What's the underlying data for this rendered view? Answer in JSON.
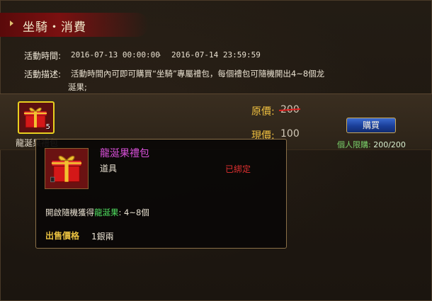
{
  "panel": {
    "title": "坐騎・消費"
  },
  "activity": {
    "time_label": "活動時間:",
    "time_start": "2016-07-13 00:00:00",
    "time_sep": "-",
    "time_end": "2016-07-14 23:59:59",
    "desc_label": "活動描述:",
    "desc_line1": "活動時間內可即可購買“坐騎”專屬禮包，每個禮包可隨機開出4~8個龙",
    "desc_line2": "涎果;"
  },
  "item": {
    "name": "龍涎果禮包",
    "quantity": "5",
    "original_price_label": "原價:",
    "original_price": "200",
    "current_price_label": "現價:",
    "current_price": "100",
    "buy_label": "購買",
    "limit_label": "個人限購:",
    "limit_value": "200/200",
    "icon": "red-gift-box-icon"
  },
  "tooltip": {
    "title": "龍涎果禮包",
    "type": "道具",
    "bound": "已綁定",
    "desc_prefix": "開啟隨機獲得",
    "desc_item": "龍涎果",
    "desc_suffix": ": 4~8個",
    "price_label": "出售價格",
    "price_value": "1銀兩"
  },
  "colors": {
    "accent_gold": "#f0c040",
    "strike_red": "#e02020",
    "tooltip_title": "#d850d8",
    "bound_red": "#e03030",
    "highlight_green": "#50e060",
    "button_blue": "#1a3e98"
  }
}
